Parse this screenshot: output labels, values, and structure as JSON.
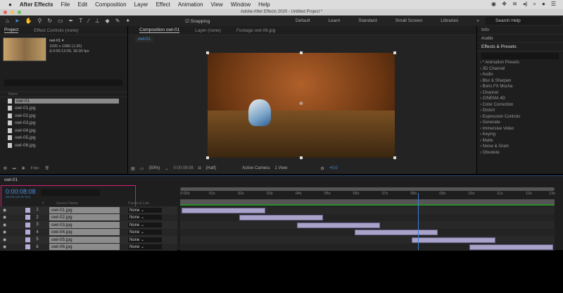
{
  "menubar": {
    "app": "After Effects",
    "items": [
      "File",
      "Edit",
      "Composition",
      "Layer",
      "Effect",
      "Animation",
      "View",
      "Window",
      "Help"
    ]
  },
  "titlebar": {
    "title": "Adobe After Effects 2020 - Untitled Project *"
  },
  "toolbar": {
    "snapping": "Snapping",
    "workspaces": [
      "Default",
      "Learn",
      "Standard",
      "Small Screen",
      "Libraries"
    ],
    "search_placeholder": "Search Help"
  },
  "project": {
    "tabs": [
      "Project",
      "Effect Controls (none)"
    ],
    "selected": {
      "name": "owl-01 ▾",
      "res": "1920 x 1080 (1.00)",
      "dur": "Δ 0:00:13:00, 30.00 fps"
    },
    "col_name": "Name",
    "items": [
      "owl-01",
      "owl-01.jpg",
      "owl-02.jpg",
      "owl-03.jpg",
      "owl-04.jpg",
      "owl-05.jpg",
      "owl-06.jpg"
    ],
    "bpc": "8 bpc"
  },
  "comp": {
    "tabs": [
      "Composition owl-01",
      "Layer (none)",
      "Footage owl-06.jpg"
    ],
    "subtab": "owl-01",
    "zoom": "(50%)",
    "time": "0:00:08:08",
    "resolution": "(Half)",
    "camera": "Active Camera",
    "views": "1 View",
    "exposure": "+0.0"
  },
  "right": {
    "info": "Info",
    "audio": "Audio",
    "effects_title": "Effects & Presets",
    "effects": [
      "* Animation Presets",
      "3D Channel",
      "Audio",
      "Blur & Sharpen",
      "Boris FX Mocha",
      "Channel",
      "CINEMA 4D",
      "Color Correction",
      "Distort",
      "Expression Controls",
      "Generate",
      "Immersive Video",
      "Keying",
      "Matte",
      "Noise & Grain",
      "Obsolete"
    ]
  },
  "timeline": {
    "tab": "owl-01",
    "timecode": "0:00:08:08",
    "frames": "00248 (30.00 fps)",
    "col_num": "#",
    "col_source": "Source Name",
    "col_parent": "Parent & Link",
    "ticks": [
      "0:00s",
      "01s",
      "02s",
      "03s",
      "04s",
      "05s",
      "06s",
      "07s",
      "08s",
      "09s",
      "10s",
      "11s",
      "12s",
      "13s"
    ],
    "playhead_s": 8.27,
    "layers": [
      {
        "num": "1",
        "name": "owl-01.jpg",
        "parent": "None",
        "in": 0,
        "out": 3
      },
      {
        "num": "2",
        "name": "owl-02.jpg",
        "parent": "None",
        "in": 2,
        "out": 5
      },
      {
        "num": "3",
        "name": "owl-03.jpg",
        "parent": "None",
        "in": 4,
        "out": 7
      },
      {
        "num": "4",
        "name": "owl-04.jpg",
        "parent": "None",
        "in": 6,
        "out": 9
      },
      {
        "num": "5",
        "name": "owl-05.jpg",
        "parent": "None",
        "in": 8,
        "out": 11
      },
      {
        "num": "6",
        "name": "owl-06.jpg",
        "parent": "None",
        "in": 10,
        "out": 13
      }
    ]
  },
  "colors": {
    "accent": "#4a8fdf",
    "highlight": "#d0207a",
    "layer_bar": "#a9a3c9"
  }
}
